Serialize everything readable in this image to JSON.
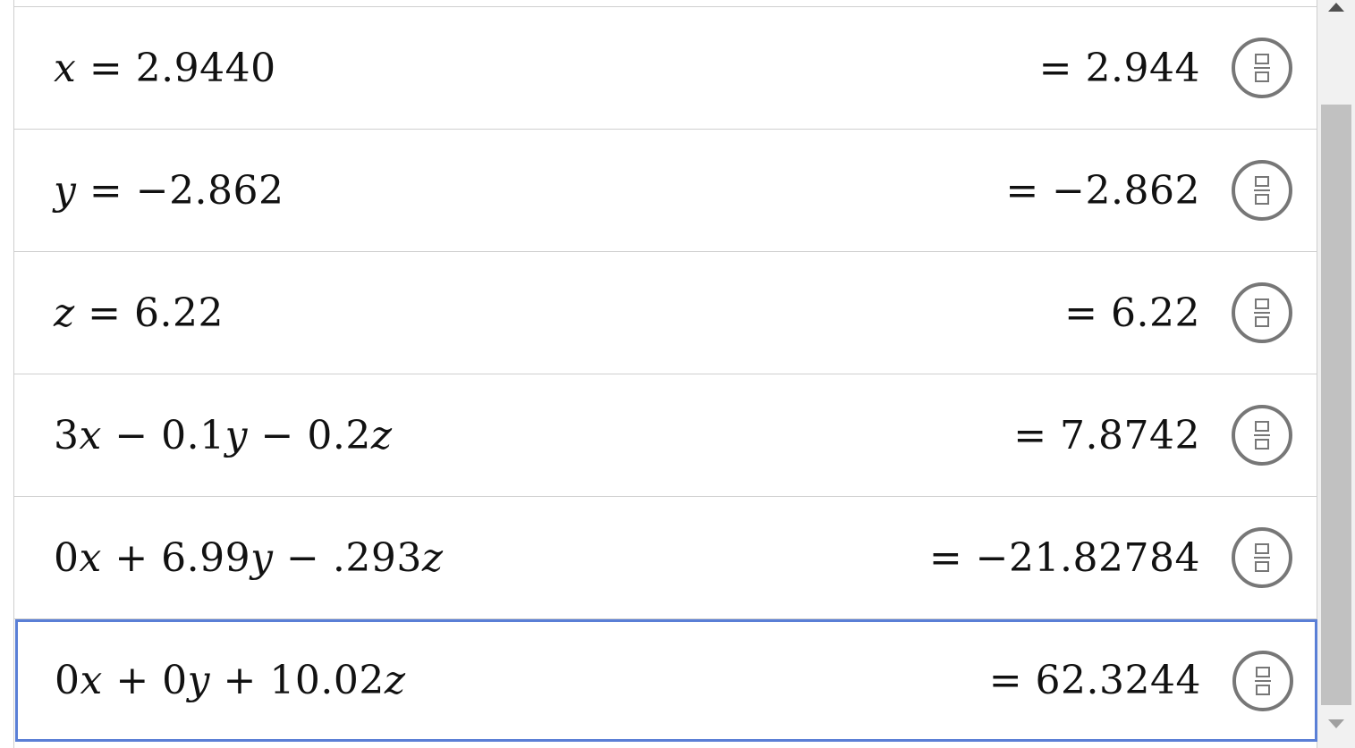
{
  "rows": [
    {
      "expression_parts": [
        {
          "t": "x",
          "i": true
        },
        {
          "t": " = 2.9440",
          "i": false
        }
      ],
      "result": "= 2.944"
    },
    {
      "expression_parts": [
        {
          "t": "y",
          "i": true
        },
        {
          "t": " = −2.862",
          "i": false
        }
      ],
      "result": "= −2.862"
    },
    {
      "expression_parts": [
        {
          "t": "z",
          "i": true
        },
        {
          "t": " = 6.22",
          "i": false
        }
      ],
      "result": "= 6.22"
    },
    {
      "expression_parts": [
        {
          "t": "3",
          "i": false
        },
        {
          "t": "x",
          "i": true
        },
        {
          "t": " − 0.1",
          "i": false
        },
        {
          "t": "y",
          "i": true
        },
        {
          "t": " − 0.2",
          "i": false
        },
        {
          "t": "z",
          "i": true
        }
      ],
      "result": "= 7.8742"
    },
    {
      "expression_parts": [
        {
          "t": "0",
          "i": false
        },
        {
          "t": "x",
          "i": true
        },
        {
          "t": " + 6.99",
          "i": false
        },
        {
          "t": "y",
          "i": true
        },
        {
          "t": " − .293",
          "i": false
        },
        {
          "t": "z",
          "i": true
        }
      ],
      "result": "= −21.82784"
    },
    {
      "expression_parts": [
        {
          "t": "0",
          "i": false
        },
        {
          "t": "x",
          "i": true
        },
        {
          "t": " + 0",
          "i": false
        },
        {
          "t": "y",
          "i": true
        },
        {
          "t": " + 10.02",
          "i": false
        },
        {
          "t": "z",
          "i": true
        }
      ],
      "result": "= 62.3244",
      "selected": true
    }
  ],
  "icons": {
    "fraction_toggle": "fraction-icon",
    "scroll_up": "triangle-up-icon",
    "scroll_down": "triangle-down-icon"
  },
  "colors": {
    "selection_border": "#5a7fd6",
    "row_divider": "#cfcfcf",
    "icon_gray": "#777777",
    "scroll_thumb": "#c1c1c1",
    "scroll_track": "#f1f1f1"
  }
}
